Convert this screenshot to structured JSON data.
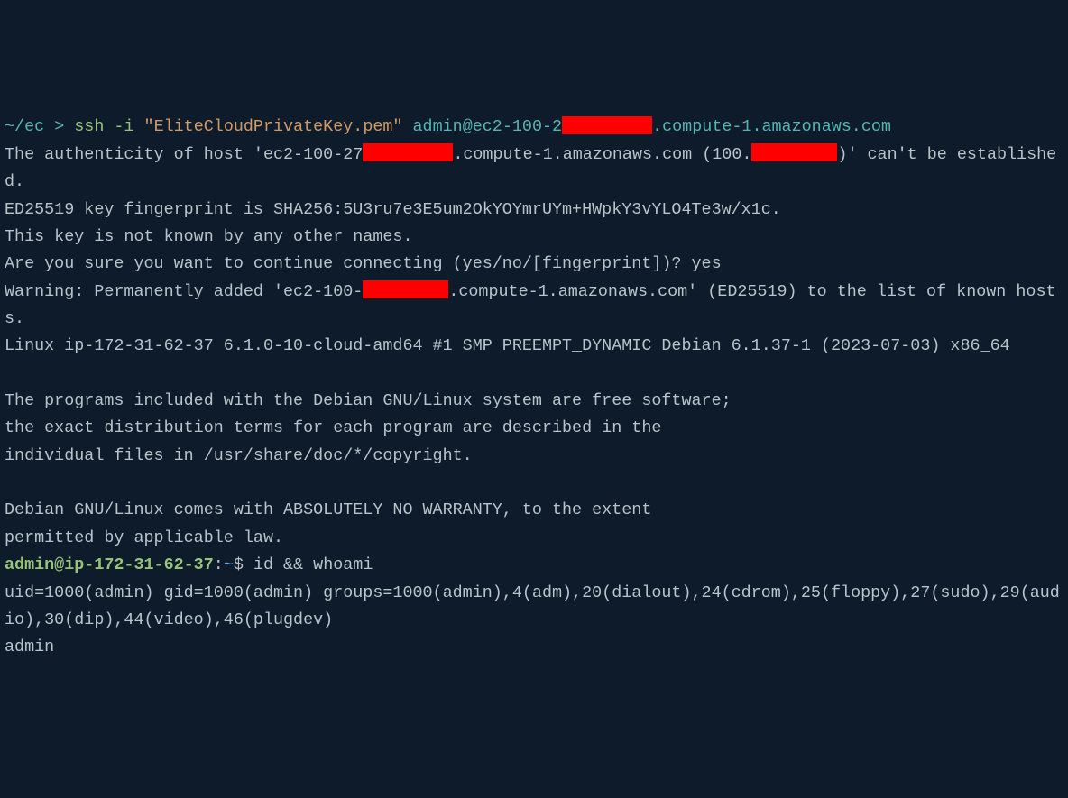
{
  "prompt1": {
    "path": "~/ec",
    "sep": " > ",
    "cmd_prefix": "ssh -i ",
    "keyfile": "\"EliteCloudPrivateKey.pem\"",
    "userhost_pre": " admin@ec2-100-2",
    "userhost_post": ".compute-1.amazonaws.com"
  },
  "auth_line_pre": "The authenticity of host 'ec2-100-27",
  "auth_line_mid": ".compute-1.amazonaws.com (100.",
  "auth_line_post": ")' can't be established.",
  "fingerprint": "ED25519 key fingerprint is SHA256:5U3ru7e3E5um2OkYOYmrUYm+HWpkY3vYLO4Te3w/x1c.",
  "unknown": "This key is not known by any other names.",
  "confirm": "Are you sure you want to continue connecting (yes/no/[fingerprint])? yes",
  "warning_pre": "Warning: Permanently added 'ec2-100-",
  "warning_post": ".compute-1.amazonaws.com' (ED25519) to the list of known hosts.",
  "linux": "Linux ip-172-31-62-37 6.1.0-10-cloud-amd64 #1 SMP PREEMPT_DYNAMIC Debian 6.1.37-1 (2023-07-03) x86_64",
  "motd1": "The programs included with the Debian GNU/Linux system are free software;",
  "motd2": "the exact distribution terms for each program are described in the",
  "motd3": "individual files in /usr/share/doc/*/copyright.",
  "motd4": "Debian GNU/Linux comes with ABSOLUTELY NO WARRANTY, to the extent",
  "motd5": "permitted by applicable law.",
  "prompt2": {
    "userhost": "admin@ip-172-31-62-37",
    "colon": ":",
    "path": "~",
    "dollar": "$ ",
    "cmd": "id && whoami"
  },
  "id_output": "uid=1000(admin) gid=1000(admin) groups=1000(admin),4(adm),20(dialout),24(cdrom),25(floppy),27(sudo),29(audio),30(dip),44(video),46(plugdev)",
  "whoami_output": "admin"
}
